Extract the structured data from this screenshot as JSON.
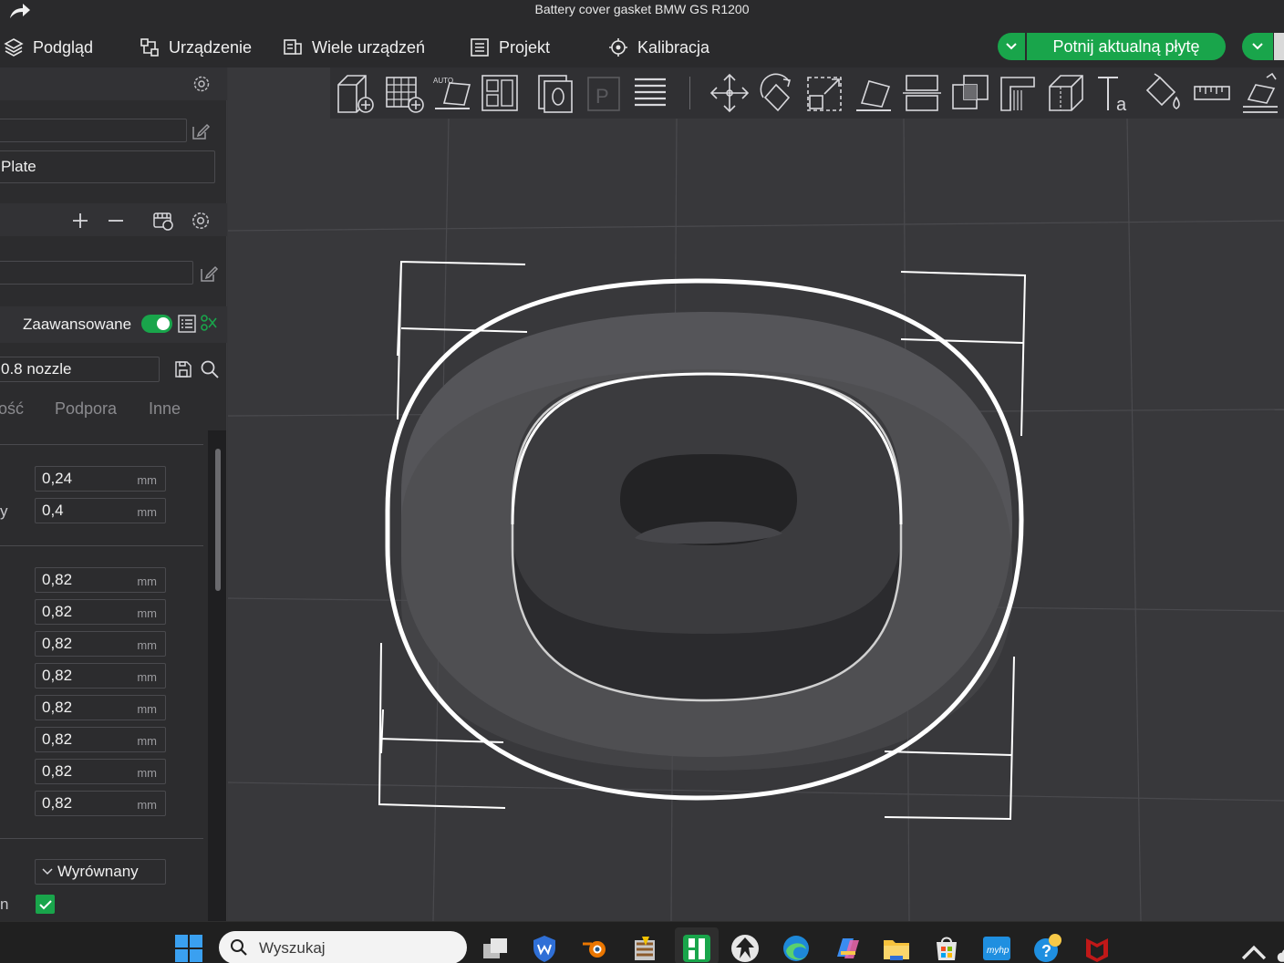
{
  "window": {
    "title": "Battery cover gasket BMW GS R1200"
  },
  "menu": {
    "items": [
      {
        "label": "Podgląd",
        "icon": "layers-icon"
      },
      {
        "label": "Urządzenie",
        "icon": "device-icon"
      },
      {
        "label": "Wiele urządzeń",
        "icon": "multi-device-icon"
      },
      {
        "label": "Projekt",
        "icon": "project-icon"
      },
      {
        "label": "Kalibracja",
        "icon": "calibration-icon"
      }
    ],
    "slice_label": "Potnij aktualną płytę"
  },
  "left_panel": {
    "plate_name": "Plate",
    "advanced_label": "Zaawansowane",
    "advanced_enabled": true,
    "preset_name": "0.8 nozzle",
    "tabs": [
      "ość",
      "Podpora",
      "Inne"
    ],
    "rows_a": [
      {
        "label": "",
        "value": "0,24",
        "unit": "mm"
      },
      {
        "label": "y",
        "value": "0,4",
        "unit": "mm"
      }
    ],
    "rows_b": [
      {
        "value": "0,82",
        "unit": "mm"
      },
      {
        "value": "0,82",
        "unit": "mm"
      },
      {
        "value": "0,82",
        "unit": "mm"
      },
      {
        "value": "0,82",
        "unit": "mm"
      },
      {
        "value": "0,82",
        "unit": "mm"
      },
      {
        "value": "0,82",
        "unit": "mm"
      },
      {
        "value": "0,82",
        "unit": "mm"
      },
      {
        "value": "0,82",
        "unit": "mm"
      }
    ],
    "seam_label": "Wyrównany",
    "last_row_label": "n",
    "last_row_checked": true
  },
  "toolbar": {
    "tools": [
      "add-object-icon",
      "add-plate-icon",
      "auto-orient-icon",
      "arrange-icon",
      "split-icon",
      "plate-p-icon",
      "layers-list-icon",
      "move-icon",
      "rotate-icon",
      "scale-icon",
      "lay-on-face-icon",
      "cut-icon",
      "boolean-icon",
      "support-paint-icon",
      "seam-paint-icon",
      "text-icon",
      "color-paint-icon",
      "measure-icon",
      "assembly-icon"
    ]
  },
  "taskbar": {
    "search_placeholder": "Wyszukaj",
    "apps": [
      "windows-start-icon",
      "task-view-icon",
      "shield-app-icon",
      "blender-icon",
      "winrar-icon",
      "bambu-studio-icon",
      "inkscape-icon",
      "edge-icon",
      "copilot-icon",
      "file-explorer-icon",
      "store-icon",
      "myhp-icon",
      "help-icon",
      "mcafee-icon",
      "chevron-up-icon",
      "cloud-icon"
    ]
  },
  "colors": {
    "accent": "#19a54b",
    "panel": "#2c2c2e",
    "viewport": "#38383b",
    "taskbar": "#202020"
  }
}
